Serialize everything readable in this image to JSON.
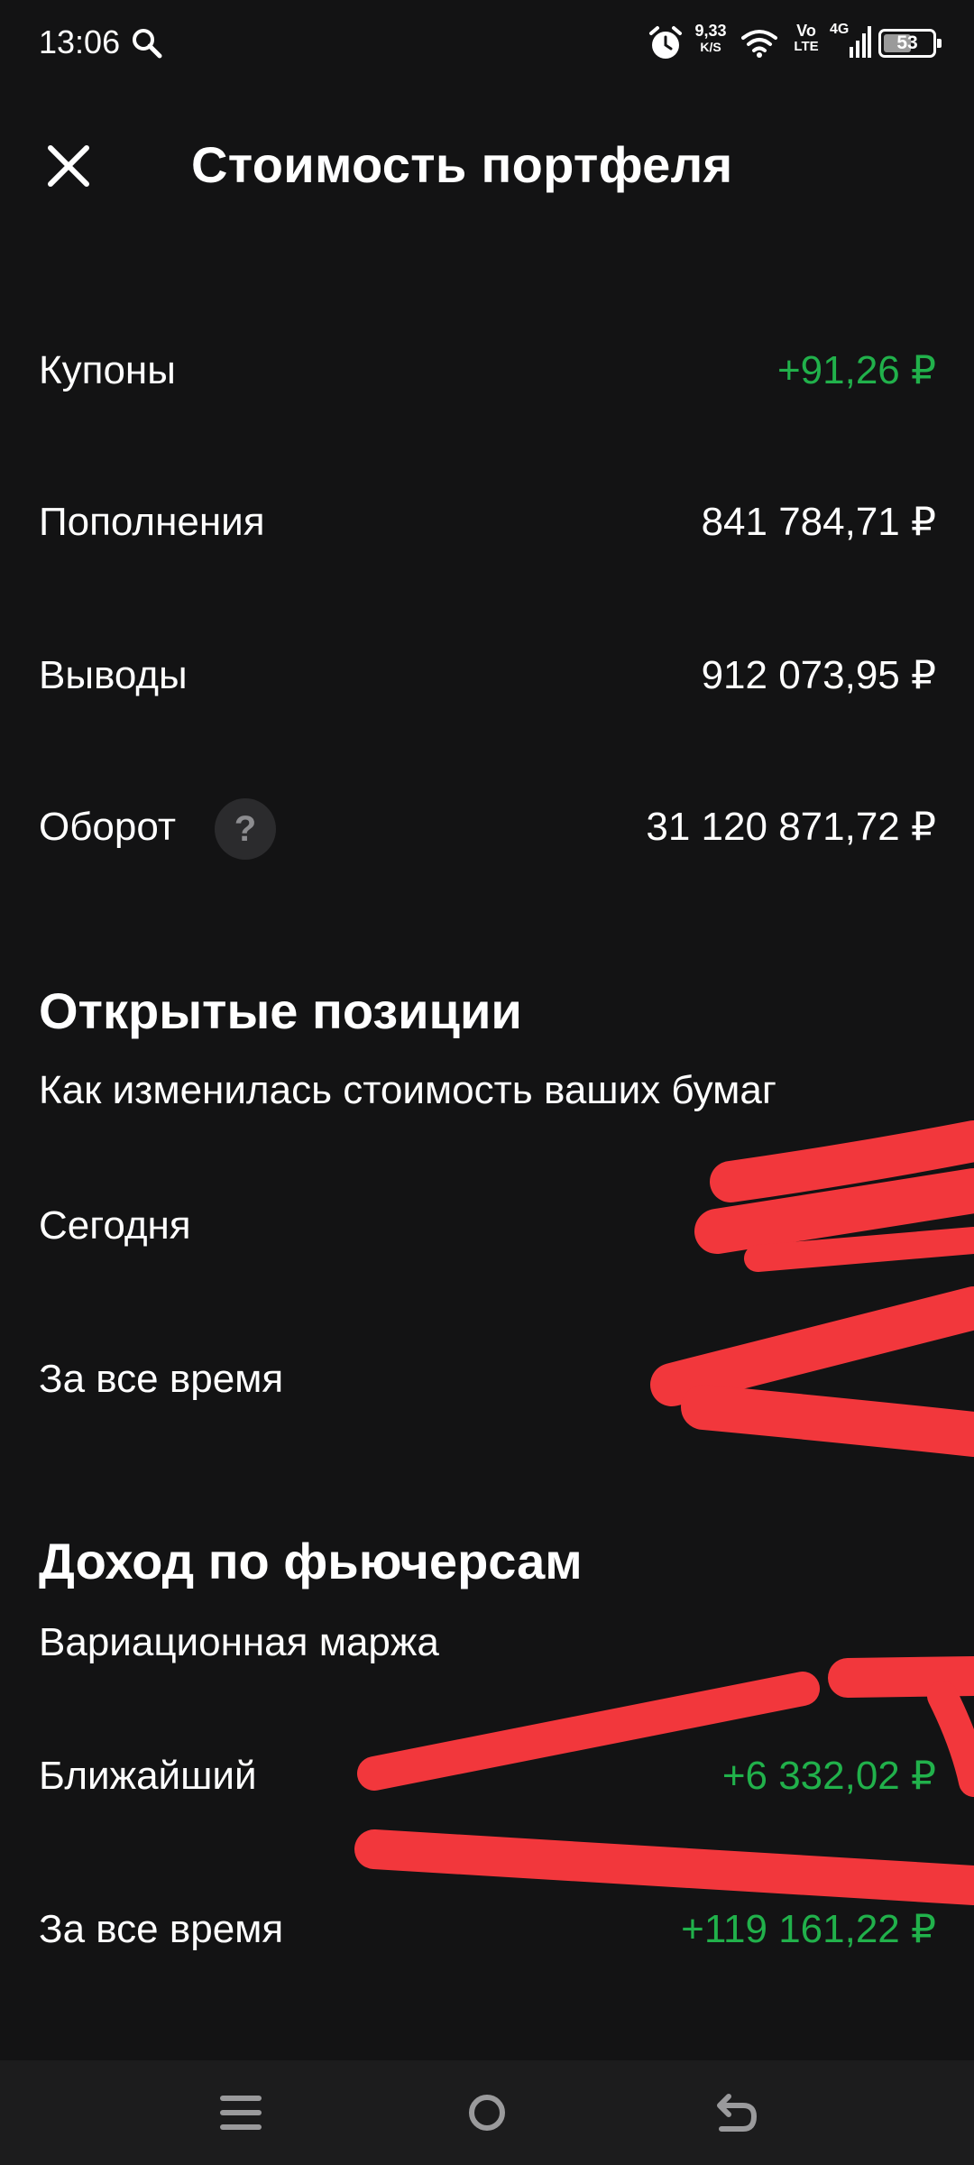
{
  "status_bar": {
    "time": "13:06",
    "net_speed_value": "9,33",
    "net_speed_unit": "K/S",
    "volte_top": "Vo",
    "volte_bottom": "LTE",
    "network_type": "4G",
    "battery_level": "53",
    "icons": [
      "search-icon",
      "alarm-icon",
      "wifi-icon",
      "signal-icon",
      "battery-icon"
    ]
  },
  "header": {
    "title": "Стоимость портфеля",
    "close_icon": "close-icon"
  },
  "summary_rows": [
    {
      "label": "Купоны",
      "value": "+91,26 ₽",
      "color": "#21b14b"
    },
    {
      "label": "Пополнения",
      "value": "841 784,71 ₽",
      "color": "#ffffff"
    },
    {
      "label": "Выводы",
      "value": "912 073,95 ₽",
      "color": "#ffffff"
    },
    {
      "label": "Оборот",
      "value": "31 120 871,72 ₽",
      "color": "#ffffff",
      "help_glyph": "?"
    }
  ],
  "open_positions": {
    "title": "Открытые позиции",
    "subtitle": "Как изменилась стоимость ваших бумаг",
    "rows": [
      {
        "label": "Сегодня"
      },
      {
        "label": "За все время"
      }
    ]
  },
  "futures": {
    "title": "Доход по фьючерсам",
    "subtitle": "Вариационная маржа",
    "rows": [
      {
        "label": "Ближайший",
        "value": "+6 332,02 ₽",
        "color": "#21b14b"
      },
      {
        "label": "За все время",
        "value": "+119 161,22 ₽",
        "color": "#21b14b"
      }
    ]
  },
  "colors": {
    "background": "#131314",
    "positive": "#21b14b",
    "redaction": "#f2373c",
    "nav_bar": "#1c1c1d"
  },
  "nav_bar": {
    "icons": [
      "menu-icon",
      "home-icon",
      "back-icon"
    ]
  }
}
